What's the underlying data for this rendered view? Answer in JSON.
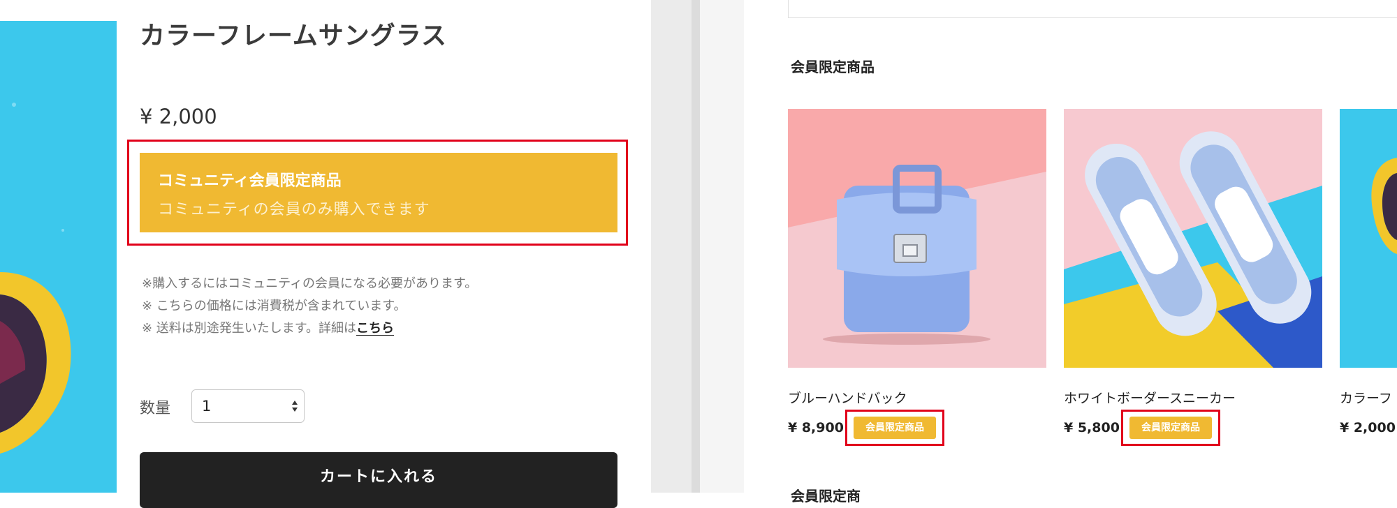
{
  "product": {
    "title": "カラーフレームサングラス",
    "price": "¥ 2,000",
    "member_box": {
      "title": "コミュニティ会員限定商品",
      "description": "コミュニティの会員のみ購入できます"
    },
    "notes": [
      "※購入するにはコミュニティの会員になる必要があります。",
      "※ こちらの価格には消費税が含まれています。",
      "※ 送料は別途発生いたします。詳細は"
    ],
    "notes_link": "こちら",
    "quantity_label": "数量",
    "quantity_value": "1",
    "cart_button": "カートに入れる"
  },
  "member_section": {
    "title": "会員限定商品",
    "products": [
      {
        "name": "ブルーハンドバック",
        "price": "¥ 8,900",
        "badge": "会員限定商品"
      },
      {
        "name": "ホワイトボーダースニーカー",
        "price": "¥ 5,800",
        "badge": "会員限定商品"
      },
      {
        "name": "カラーフ",
        "price": "¥ 2,000"
      }
    ],
    "next_title": "会員限定商"
  },
  "colors": {
    "accent": "#f0b932",
    "highlight": "#e1001a",
    "button": "#222222",
    "hero_background": "#3cc8ec"
  },
  "icons": {
    "quantity_arrows": "chevron-updown-icon"
  }
}
